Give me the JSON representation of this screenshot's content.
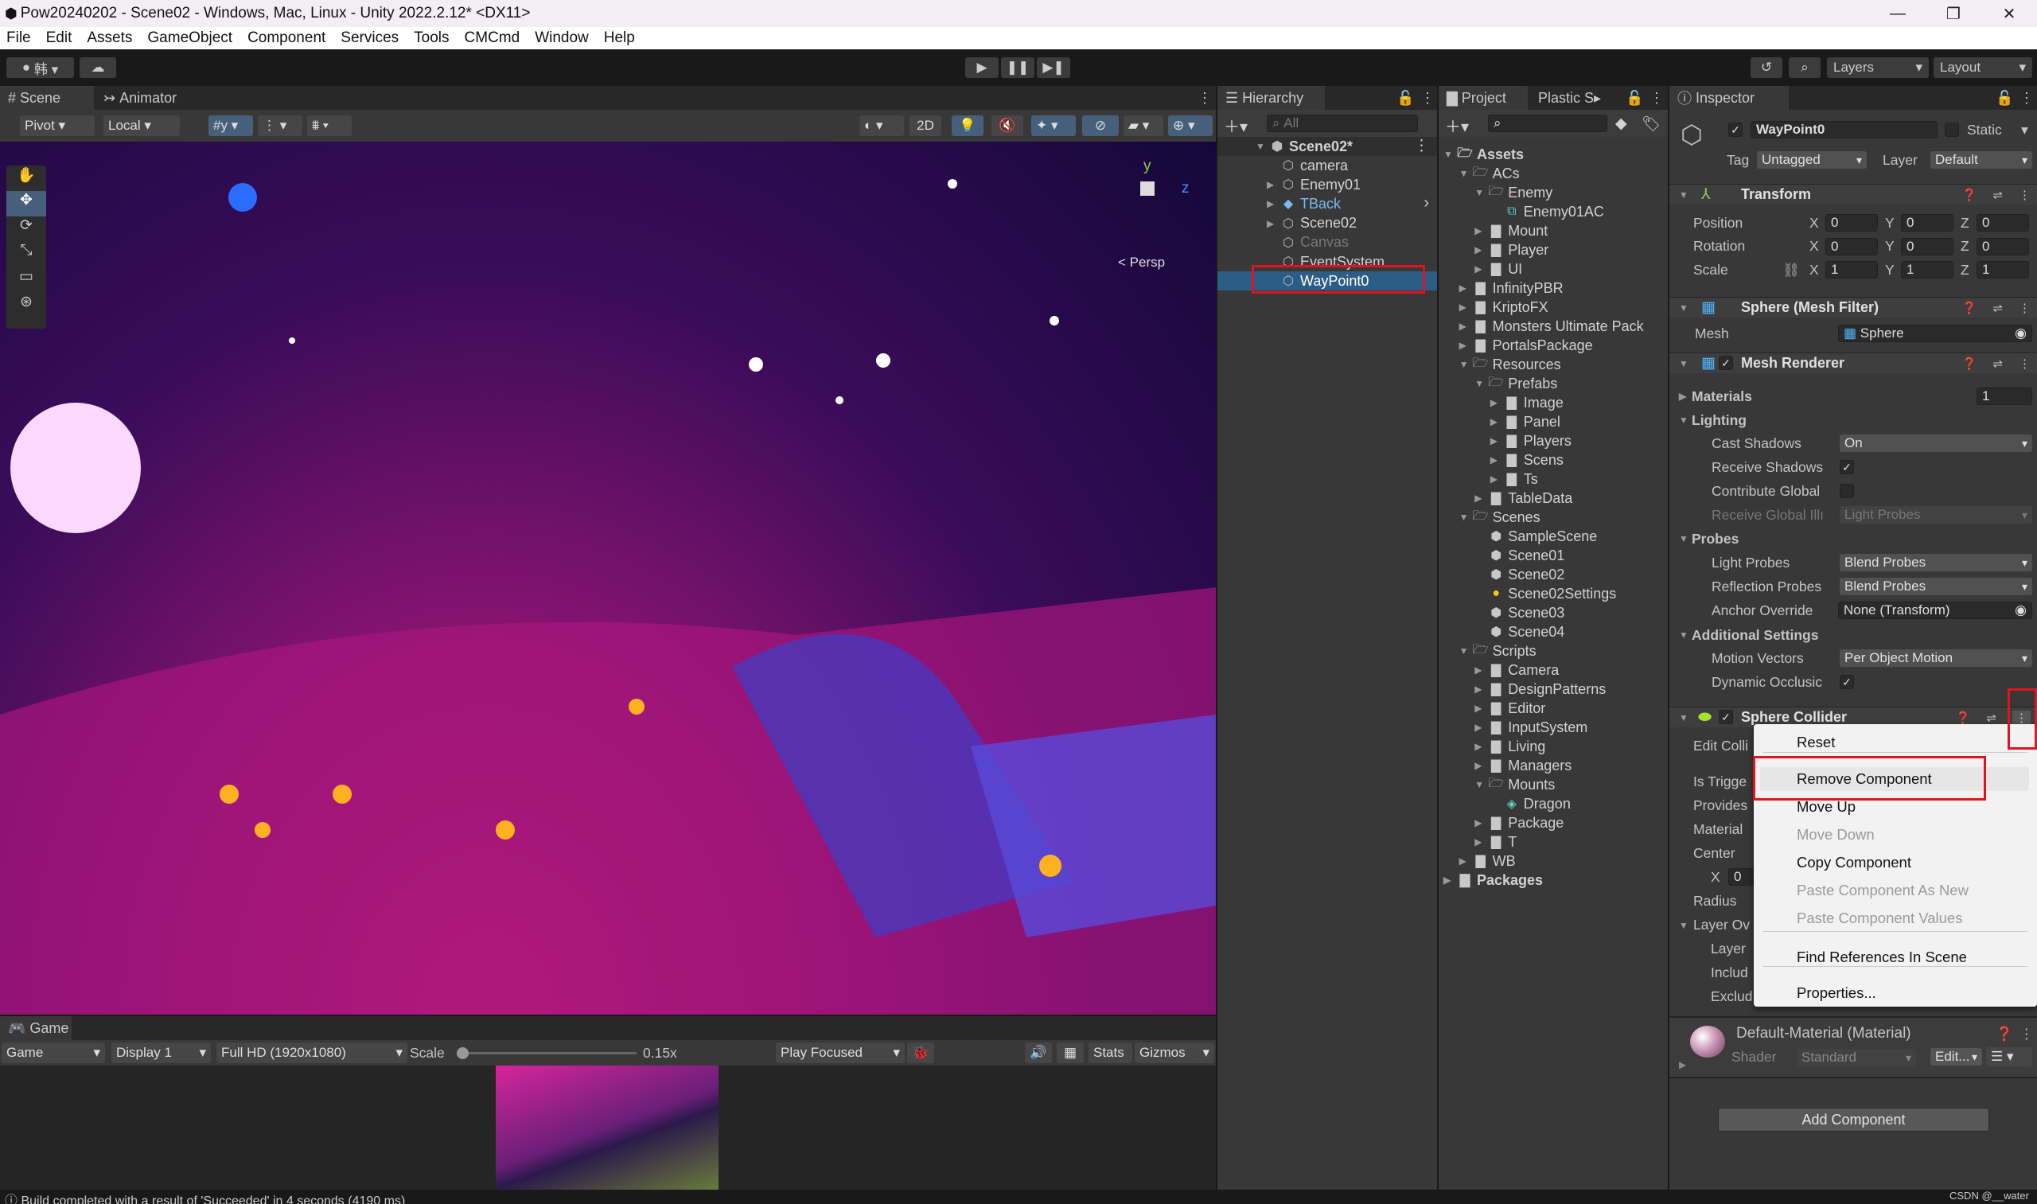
{
  "window": {
    "title": "Pow20240202 - Scene02 - Windows, Mac, Linux - Unity 2022.2.12* <DX11>",
    "minimize": "—",
    "maximize": "❐",
    "close": "✕"
  },
  "menu": [
    "File",
    "Edit",
    "Assets",
    "GameObject",
    "Component",
    "Services",
    "Tools",
    "CMCmd",
    "Window",
    "Help"
  ],
  "toolbar": {
    "account": "韩 ▾",
    "play": "▶",
    "pause": "❚❚",
    "step": "▶❚",
    "layers": "Layers",
    "layout": "Layout"
  },
  "scene": {
    "tabs": [
      "Scene",
      "Animator"
    ],
    "pivot": "Pivot",
    "local": "Local",
    "mode2d": "2D",
    "persp": "< Persp",
    "gizmo_y": "y",
    "gizmo_z": "z"
  },
  "game": {
    "tab": "Game",
    "view": "Game",
    "display": "Display 1",
    "resolution": "Full HD (1920x1080)",
    "scale_label": "Scale",
    "scale_value": "0.15x",
    "scale_fraction": 0.0,
    "play_mode": "Play Focused",
    "stats": "Stats",
    "gizmos": "Gizmos"
  },
  "status": {
    "message": "Build completed with a result of 'Succeeded' in 4 seconds (4190 ms)"
  },
  "hierarchy": {
    "tab": "Hierarchy",
    "search_placeholder": "All",
    "scene": "Scene02*",
    "items": [
      {
        "label": "camera",
        "expandable": false
      },
      {
        "label": "Enemy01",
        "expandable": true
      },
      {
        "label": "TBack",
        "expandable": true,
        "prefab": true
      },
      {
        "label": "Scene02",
        "expandable": true
      },
      {
        "label": "Canvas",
        "expandable": false,
        "inactive": true
      },
      {
        "label": "EventSystem",
        "expandable": false
      },
      {
        "label": "WayPoint0",
        "expandable": false,
        "selected": true
      }
    ]
  },
  "project": {
    "tabs": [
      "Project",
      "Plastic S"
    ],
    "items": [
      {
        "label": "Assets",
        "depth": 0,
        "type": "folder-open",
        "bold": true
      },
      {
        "label": "ACs",
        "depth": 1,
        "type": "folder-open"
      },
      {
        "label": "Enemy",
        "depth": 2,
        "type": "folder-open"
      },
      {
        "label": "Enemy01AC",
        "depth": 3,
        "type": "animator"
      },
      {
        "label": "Mount",
        "depth": 2,
        "type": "folder"
      },
      {
        "label": "Player",
        "depth": 2,
        "type": "folder"
      },
      {
        "label": "UI",
        "depth": 2,
        "type": "folder"
      },
      {
        "label": "InfinityPBR",
        "depth": 1,
        "type": "folder"
      },
      {
        "label": "KriptoFX",
        "depth": 1,
        "type": "folder"
      },
      {
        "label": "Monsters Ultimate Pack",
        "depth": 1,
        "type": "folder"
      },
      {
        "label": "PortalsPackage",
        "depth": 1,
        "type": "folder"
      },
      {
        "label": "Resources",
        "depth": 1,
        "type": "folder-open"
      },
      {
        "label": "Prefabs",
        "depth": 2,
        "type": "folder-open"
      },
      {
        "label": "Image",
        "depth": 3,
        "type": "folder"
      },
      {
        "label": "Panel",
        "depth": 3,
        "type": "folder"
      },
      {
        "label": "Players",
        "depth": 3,
        "type": "folder"
      },
      {
        "label": "Scens",
        "depth": 3,
        "type": "folder"
      },
      {
        "label": "Ts",
        "depth": 3,
        "type": "folder"
      },
      {
        "label": "TableData",
        "depth": 2,
        "type": "folder"
      },
      {
        "label": "Scenes",
        "depth": 1,
        "type": "folder-open"
      },
      {
        "label": "SampleScene",
        "depth": 2,
        "type": "scene"
      },
      {
        "label": "Scene01",
        "depth": 2,
        "type": "scene"
      },
      {
        "label": "Scene02",
        "depth": 2,
        "type": "scene"
      },
      {
        "label": "Scene02Settings",
        "depth": 2,
        "type": "lighting"
      },
      {
        "label": "Scene03",
        "depth": 2,
        "type": "scene"
      },
      {
        "label": "Scene04",
        "depth": 2,
        "type": "scene"
      },
      {
        "label": "Scripts",
        "depth": 1,
        "type": "folder-open"
      },
      {
        "label": "Camera",
        "depth": 2,
        "type": "folder"
      },
      {
        "label": "DesignPatterns",
        "depth": 2,
        "type": "folder"
      },
      {
        "label": "Editor",
        "depth": 2,
        "type": "folder"
      },
      {
        "label": "InputSystem",
        "depth": 2,
        "type": "folder"
      },
      {
        "label": "Living",
        "depth": 2,
        "type": "folder"
      },
      {
        "label": "Managers",
        "depth": 2,
        "type": "folder"
      },
      {
        "label": "Mounts",
        "depth": 2,
        "type": "folder-open"
      },
      {
        "label": "Dragon",
        "depth": 3,
        "type": "prefab"
      },
      {
        "label": "Package",
        "depth": 2,
        "type": "folder"
      },
      {
        "label": "T",
        "depth": 2,
        "type": "folder"
      },
      {
        "label": "WB",
        "depth": 1,
        "type": "folder"
      },
      {
        "label": "Packages",
        "depth": 0,
        "type": "folder",
        "bold": true
      }
    ]
  },
  "inspector": {
    "tab": "Inspector",
    "object_name": "WayPoint0",
    "active": true,
    "static_label": "Static",
    "tag_label": "Tag",
    "tag": "Untagged",
    "layer_label": "Layer",
    "layer": "Default",
    "transform": {
      "title": "Transform",
      "rows": [
        {
          "label": "Position",
          "x": "0",
          "y": "0",
          "z": "0"
        },
        {
          "label": "Rotation",
          "x": "0",
          "y": "0",
          "z": "0"
        },
        {
          "label": "Scale",
          "x": "1",
          "y": "1",
          "z": "1"
        }
      ],
      "axis": [
        "X",
        "Y",
        "Z"
      ]
    },
    "mesh_filter": {
      "title": "Sphere (Mesh Filter)",
      "mesh_label": "Mesh",
      "mesh": "Sphere"
    },
    "mesh_renderer": {
      "title": "Mesh Renderer",
      "materials_label": "Materials",
      "materials_count": "1",
      "lighting": "Lighting",
      "cast_shadows_label": "Cast Shadows",
      "cast_shadows": "On",
      "receive_shadows_label": "Receive Shadows",
      "contribute_gi_label": "Contribute Global",
      "receive_gi_label": "Receive Global Illı",
      "receive_gi": "Light Probes",
      "probes": "Probes",
      "light_probes_label": "Light Probes",
      "light_probes": "Blend Probes",
      "reflection_probes_label": "Reflection Probes",
      "reflection_probes": "Blend Probes",
      "anchor_label": "Anchor Override",
      "anchor": "None (Transform)",
      "additional": "Additional Settings",
      "motion_vectors_label": "Motion Vectors",
      "motion_vectors": "Per Object Motion",
      "dynamic_occlusion_label": "Dynamic Occlusic"
    },
    "sphere_collider": {
      "title": "Sphere Collider",
      "rows": [
        "Edit Colli",
        "Is Trigge",
        "Provides",
        "Material",
        "Center",
        "Radius",
        "Layer Ov",
        "Layer",
        "Includ",
        "Exclud"
      ],
      "center_x_label": "X",
      "center_x": "0"
    },
    "material": {
      "title": "Default-Material (Material)",
      "shader_label": "Shader",
      "shader": "Standard",
      "edit": "Edit..."
    },
    "add_component": "Add Component"
  },
  "context_menu": {
    "items": [
      {
        "label": "Reset",
        "enabled": true
      },
      {
        "label": "Remove Component",
        "enabled": true,
        "highlighted": true
      },
      {
        "label": "Move Up",
        "enabled": true
      },
      {
        "label": "Move Down",
        "enabled": false
      },
      {
        "label": "Copy Component",
        "enabled": true
      },
      {
        "label": "Paste Component As New",
        "enabled": false
      },
      {
        "label": "Paste Component Values",
        "enabled": false
      },
      {
        "label": "Find References In Scene",
        "enabled": true
      },
      {
        "label": "Properties...",
        "enabled": true
      }
    ]
  },
  "watermark": "CSDN @__water",
  "colors": {
    "accent_blue": "#2c5d87",
    "highlight_red": "#e0141e",
    "prefab_blue": "#7bb8f0"
  }
}
